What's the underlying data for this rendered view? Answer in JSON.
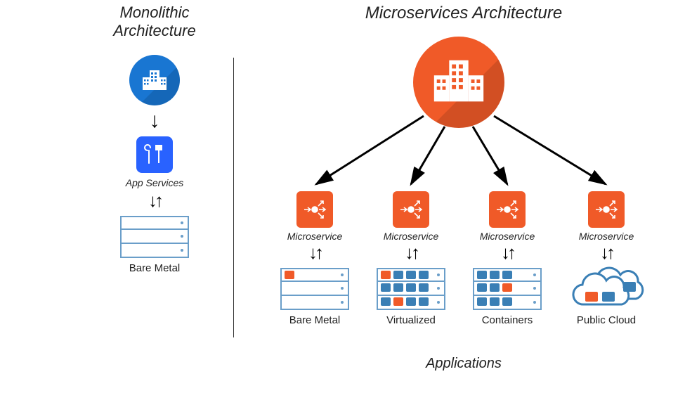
{
  "left": {
    "title_l1": "Monolithic",
    "title_l2": "Architecture",
    "app_services_label": "App Services",
    "deploy_label": "Bare Metal"
  },
  "right": {
    "title": "Microservices Architecture",
    "applications_label": "Applications",
    "microservice_label": "Microservice",
    "deploy_labels": [
      "Bare Metal",
      "Virtualized",
      "Containers",
      "Public Cloud"
    ]
  },
  "colors": {
    "blue_circle": "#1976d2",
    "orange": "#f05a28",
    "blue_box": "#2962ff",
    "server_border": "#6a9ec9"
  },
  "icons": {
    "buildings": "buildings-icon",
    "tools": "wrench-hammer-icon",
    "microservice": "load-balancer-icon",
    "cloud": "cloud-icon"
  }
}
